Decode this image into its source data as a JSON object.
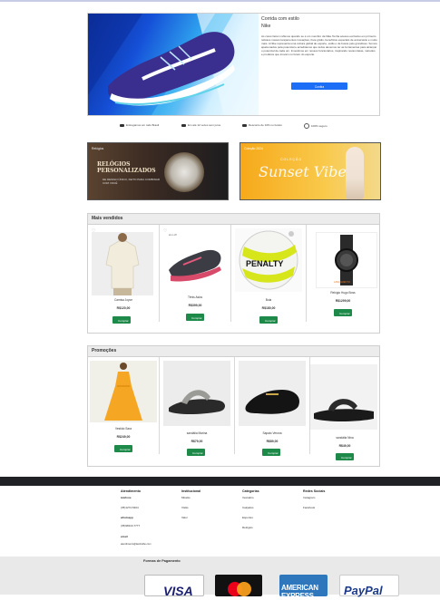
{
  "hero": {
    "title": "Corrida com estilo",
    "subtitle": "Nike",
    "description": "As cores fazem reflexos quando se é um membro da Nike.Tenha acesso exclusivo em primeiro relicaos nossos lançamentos inovações, frete grátis, benefícios especiais de aniversário e muito mais. A Nike representa uma cultura global de esporte, estilo e de busca pelo grandioso. Somos apaixonados pela potencial e acreditamos que todos devemos ter as ferramentas para alcançar o potencial de cada um. Investimos em nossos funcionários, inspirando novas ideias, métodos e produtos que inovam no futuro do esporte.",
    "button": "Confira"
  },
  "features": [
    {
      "label": "Entregamos em todo Brasil",
      "icon": "truck-icon"
    },
    {
      "label": "Em até 12 vezes sem juros",
      "icon": "credit-card-icon"
    },
    {
      "label": "Desconto de 10% no boleto",
      "icon": "barcode-icon"
    },
    {
      "label": "100% seguro",
      "icon": "shield-icon"
    }
  ],
  "banners": {
    "left": {
      "tag": "Relógios",
      "title": "RELÓGIOS PERSONALIZADOS",
      "subtitle": "DE DESIGN ÚNICO, FEITO PARA COMBINAR COM VOCÊ"
    },
    "right": {
      "tag": "Coleção 2024",
      "small": "COLEÇÃO",
      "script": "Sunset Vibe"
    }
  },
  "mais_vendidos": {
    "title": "Mais vendidos",
    "items": [
      {
        "name": "Camisa Joyce",
        "price": "R$120,00",
        "button": "Comprar"
      },
      {
        "name": "Tênis Asics",
        "price": "R$399,00",
        "button": "Comprar",
        "badge": "só o off"
      },
      {
        "name": "Bola",
        "price": "R$180,00",
        "button": "Comprar"
      },
      {
        "name": "Relógio Hugo Boss",
        "price": "R$1299,00",
        "button": "Comprar",
        "badge": "LANÇAMENTO"
      }
    ]
  },
  "promocoes": {
    "title": "Promoções",
    "items": [
      {
        "name": "Vestido Sara",
        "price": "R$249,00",
        "button": "Comprar"
      },
      {
        "name": "sandália Marina",
        "price": "R$79,00",
        "button": "Comprar"
      },
      {
        "name": "Sapato Verona",
        "price": "R$89,00",
        "button": "Comprar"
      },
      {
        "name": "sandália Nina",
        "price": "R$49,00",
        "button": "Comprar"
      }
    ]
  },
  "footer": {
    "atendimento": {
      "title": "Atendimento",
      "telefone_label": "telefone",
      "telefone": "(35)1272-5404",
      "whatsapp_label": "whatsapp",
      "whatsapp": "(35)98110-7777",
      "email_label": "email",
      "email": "atendimento@lavshelbe.com"
    },
    "institucional": {
      "title": "Institucional",
      "items": [
        "Missão",
        "Visão",
        "Valor"
      ]
    },
    "categorias": {
      "title": "Categorias",
      "items": [
        "Vestuário",
        "Calçados",
        "Esportes",
        "Relógios"
      ]
    },
    "redes": {
      "title": "Redes Sociais",
      "items": [
        "Instagram",
        "Facebook"
      ]
    }
  },
  "payment": {
    "title": "Formas de Pagamento",
    "cards": [
      "VISA",
      "mastercard",
      "AMERICAN EXPRESS",
      "PayPal"
    ]
  },
  "colors": {
    "accent_blue": "#1b6ef5",
    "buy_green": "#1e8a4a",
    "footer_dark": "#1f2124"
  }
}
